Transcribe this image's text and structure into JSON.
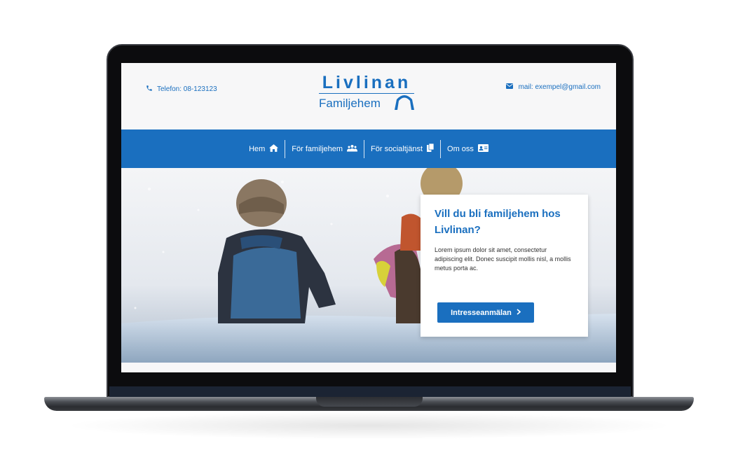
{
  "header": {
    "phone_text": "Telefon: 08-123123",
    "email_text": "mail: exempel@gmail.com"
  },
  "logo": {
    "title": "Livlinan",
    "subtitle": "Familjehem"
  },
  "nav": {
    "items": [
      {
        "label": "Hem",
        "icon": "home-icon"
      },
      {
        "label": "För familjehem",
        "icon": "users-icon"
      },
      {
        "label": "För socialtjänst",
        "icon": "copy-icon"
      },
      {
        "label": "Om oss",
        "icon": "id-card-icon"
      }
    ]
  },
  "hero": {
    "title": "Vill du bli familjehem hos Livlinan?",
    "text": "Lorem ipsum dolor sit amet, consectetur adipiscing elit. Donec suscipit mollis nisl, a mollis metus porta ac.",
    "cta_label": "Intresseanmälan",
    "cta_icon": "chevron-right-icon"
  },
  "colors": {
    "brand_blue": "#1a6fbf",
    "header_bg": "#f7f7f8",
    "text_dark": "#333333"
  }
}
